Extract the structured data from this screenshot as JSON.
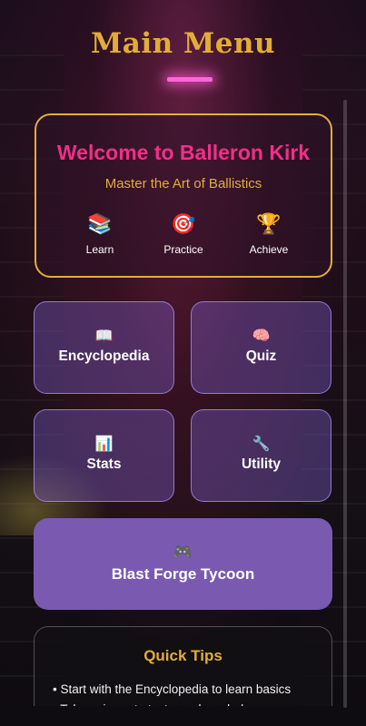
{
  "page": {
    "title": "Main Menu"
  },
  "welcome": {
    "title": "Welcome to Balleron Kirk",
    "subtitle": "Master the Art of Ballistics",
    "features": [
      {
        "icon": "books-icon",
        "glyph": "📚",
        "label": "Learn"
      },
      {
        "icon": "target-icon",
        "glyph": "🎯",
        "label": "Practice"
      },
      {
        "icon": "trophy-icon",
        "glyph": "🏆",
        "label": "Achieve"
      }
    ]
  },
  "menu": {
    "tiles": [
      {
        "icon": "book-icon",
        "glyph": "📖",
        "label": "Encyclopedia"
      },
      {
        "icon": "brain-icon",
        "glyph": "🧠",
        "label": "Quiz"
      },
      {
        "icon": "bar-chart-icon",
        "glyph": "📊",
        "label": "Stats"
      },
      {
        "icon": "wrench-icon",
        "glyph": "🔧",
        "label": "Utility"
      }
    ],
    "featured": {
      "icon": "gamepad-icon",
      "glyph": "🎮",
      "label": "Blast Forge Tycoon"
    }
  },
  "tips": {
    "title": "Quick Tips",
    "items": [
      "Start with the Encyclopedia to learn basics",
      "Take quizzes to test your knowledge"
    ]
  },
  "colors": {
    "title_gold": "#e1ad35",
    "welcome_pink": "#f02f87",
    "button_purple": "#7a5ab0"
  }
}
